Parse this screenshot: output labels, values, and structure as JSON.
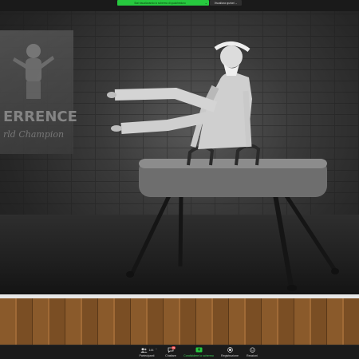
{
  "banner": {
    "share_notice": "Stai visualizzando lo schermo di qualcheduno",
    "share_chevron": "⌄",
    "view_options": "Visualizza opzioni ⌄"
  },
  "shared_content": {
    "poster_line1": "ERRENCE",
    "poster_line2": "rld Champion"
  },
  "toolbar": {
    "participants_label": "Partecipanti",
    "participants_count": "144",
    "participants_caret": "^",
    "chat_label": "Chattare",
    "chat_badge": "99",
    "share_label": "Condividere lo schermo",
    "record_label": "Registrazione",
    "reactions_label": "Reazioni"
  },
  "colors": {
    "share_green": "#27c93f",
    "toolbar_bg": "#1b1b1b"
  }
}
